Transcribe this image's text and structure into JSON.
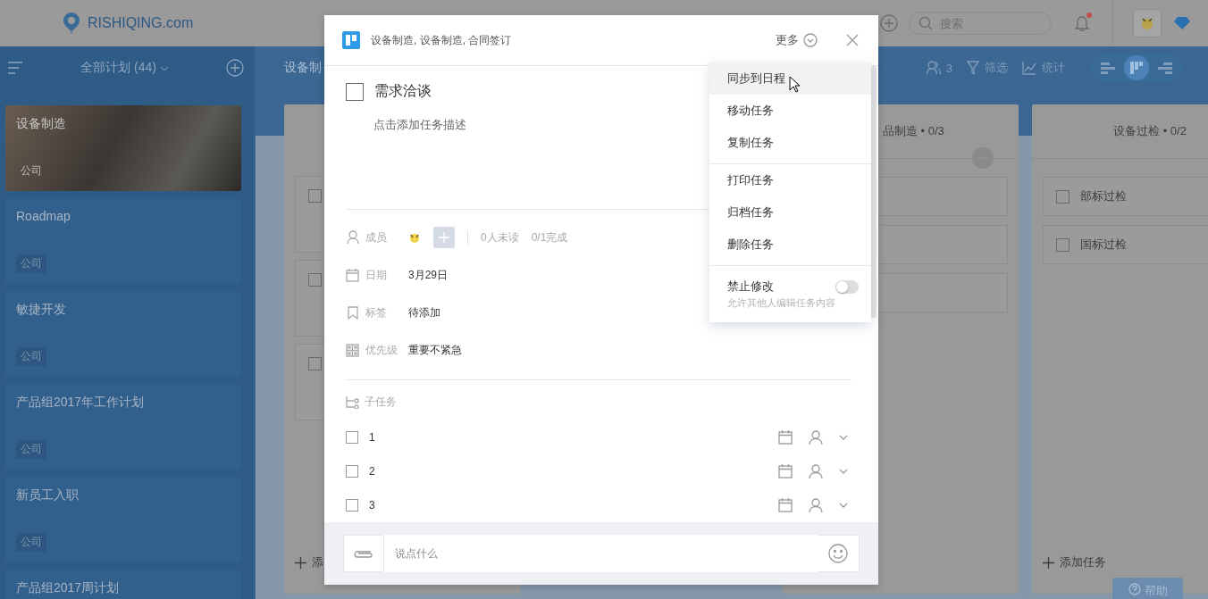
{
  "header": {
    "logo": "RISHIQING.com",
    "search": {
      "placeholder": "搜索"
    },
    "unread": true
  },
  "sidebar": {
    "title": "全部计划 (44)",
    "plans": [
      {
        "name": "设备制造",
        "tag": "公司",
        "kind": "photo"
      },
      {
        "name": "Roadmap",
        "tag": "公司",
        "kind": "plain"
      },
      {
        "name": "敏捷开发",
        "tag": "公司",
        "kind": "plain"
      },
      {
        "name": "产品组2017年工作计划",
        "tag": "公司",
        "kind": "plain"
      },
      {
        "name": "新员工入职",
        "tag": "公司",
        "kind": "plain"
      },
      {
        "name": "产品组2017周计划",
        "kind": "plain"
      }
    ]
  },
  "toolbar": {
    "board_title": "设备制",
    "members": "3",
    "filter": "筛选",
    "stats": "统计",
    "views": [
      {
        "selected": false
      },
      {
        "selected": true
      },
      {
        "selected": false
      }
    ]
  },
  "board": {
    "columns": [
      {
        "tasks": [
          {
            "checked": false
          },
          {
            "checked": false
          },
          {
            "checked": false
          }
        ],
        "add_label": "添"
      },
      {
        "title": "品制造 • 0/3"
      },
      {
        "title": "设备过检 • 0/2",
        "tasks": [
          {
            "name": "部标过检",
            "checked": false
          },
          {
            "name": "国标过检",
            "checked": false
          }
        ],
        "add_label": "添加任务"
      }
    ]
  },
  "help_button": "帮助",
  "task_dialog": {
    "breadcrumb": "设备制造, 设备制造, 合同签订",
    "more": "更多",
    "title": "需求洽谈",
    "done": false,
    "description_placeholder": "点击添加任务描述",
    "fields": [
      {
        "kind": "members",
        "label": "成员",
        "unread": "0人未读",
        "progress": "0/1完成"
      },
      {
        "kind": "date",
        "label": "日期",
        "value": "3月29日"
      },
      {
        "kind": "tag",
        "label": "标签",
        "value": "待添加"
      },
      {
        "kind": "priority",
        "label": "优先级",
        "value": "重要不紧急"
      }
    ],
    "subtasks_label": "子任务",
    "subtasks": [
      {
        "name": "1",
        "checked": false
      },
      {
        "name": "2",
        "checked": false
      },
      {
        "name": "3",
        "checked": false
      }
    ],
    "comment": {
      "placeholder": "说点什么"
    }
  },
  "more_menu": {
    "groups": [
      {
        "items": [
          {
            "label": "同步到日程",
            "selected": true
          },
          {
            "label": "移动任务",
            "selected": false
          },
          {
            "label": "复制任务",
            "selected": false
          }
        ]
      },
      {
        "items": [
          {
            "label": "打印任务",
            "selected": false
          },
          {
            "label": "归档任务",
            "selected": false
          },
          {
            "label": "删除任务",
            "selected": false
          }
        ]
      }
    ],
    "lock": {
      "label": "禁止修改",
      "hint": "允许其他人编辑任务内容",
      "on": false
    }
  }
}
